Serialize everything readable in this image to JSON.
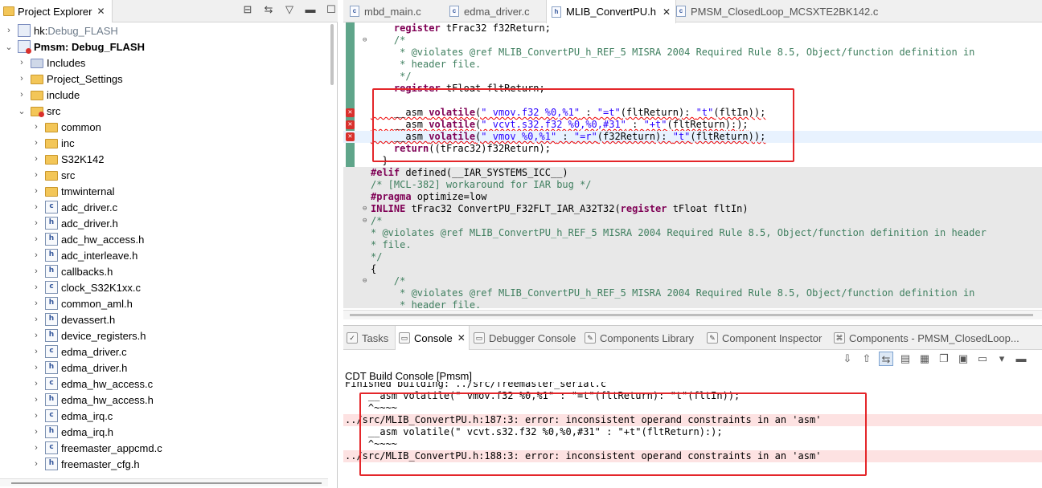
{
  "explorer": {
    "title": "Project Explorer",
    "close": "✕",
    "tree": [
      {
        "level": 0,
        "chev": "›",
        "icon": "project",
        "label": "hk:",
        "suffix": " Debug_FLASH",
        "bold": false
      },
      {
        "level": 0,
        "chev": "⌄",
        "icon": "project-err",
        "label": "Pmsm: Debug_FLASH",
        "suffix": "",
        "bold": true
      },
      {
        "level": 1,
        "chev": "›",
        "icon": "includes",
        "label": "Includes",
        "suffix": "",
        "bold": false
      },
      {
        "level": 1,
        "chev": "›",
        "icon": "folder",
        "label": "Project_Settings",
        "suffix": "",
        "bold": false
      },
      {
        "level": 1,
        "chev": "›",
        "icon": "folder",
        "label": "include",
        "suffix": "",
        "bold": false
      },
      {
        "level": 1,
        "chev": "⌄",
        "icon": "src-err",
        "label": "src",
        "suffix": "",
        "bold": false
      },
      {
        "level": 2,
        "chev": "›",
        "icon": "folder",
        "label": "common",
        "suffix": "",
        "bold": false
      },
      {
        "level": 2,
        "chev": "›",
        "icon": "folder",
        "label": "inc",
        "suffix": "",
        "bold": false
      },
      {
        "level": 2,
        "chev": "›",
        "icon": "folder",
        "label": "S32K142",
        "suffix": "",
        "bold": false
      },
      {
        "level": 2,
        "chev": "›",
        "icon": "folder",
        "label": "src",
        "suffix": "",
        "bold": false
      },
      {
        "level": 2,
        "chev": "›",
        "icon": "folder",
        "label": "tmwinternal",
        "suffix": "",
        "bold": false
      },
      {
        "level": 2,
        "chev": "›",
        "icon": "c",
        "label": "adc_driver.c",
        "suffix": "",
        "bold": false
      },
      {
        "level": 2,
        "chev": "›",
        "icon": "h",
        "label": "adc_driver.h",
        "suffix": "",
        "bold": false
      },
      {
        "level": 2,
        "chev": "›",
        "icon": "h",
        "label": "adc_hw_access.h",
        "suffix": "",
        "bold": false
      },
      {
        "level": 2,
        "chev": "›",
        "icon": "h",
        "label": "adc_interleave.h",
        "suffix": "",
        "bold": false
      },
      {
        "level": 2,
        "chev": "›",
        "icon": "h",
        "label": "callbacks.h",
        "suffix": "",
        "bold": false
      },
      {
        "level": 2,
        "chev": "›",
        "icon": "c",
        "label": "clock_S32K1xx.c",
        "suffix": "",
        "bold": false
      },
      {
        "level": 2,
        "chev": "›",
        "icon": "h",
        "label": "common_aml.h",
        "suffix": "",
        "bold": false
      },
      {
        "level": 2,
        "chev": "›",
        "icon": "h",
        "label": "devassert.h",
        "suffix": "",
        "bold": false
      },
      {
        "level": 2,
        "chev": "›",
        "icon": "h",
        "label": "device_registers.h",
        "suffix": "",
        "bold": false
      },
      {
        "level": 2,
        "chev": "›",
        "icon": "c",
        "label": "edma_driver.c",
        "suffix": "",
        "bold": false
      },
      {
        "level": 2,
        "chev": "›",
        "icon": "h",
        "label": "edma_driver.h",
        "suffix": "",
        "bold": false
      },
      {
        "level": 2,
        "chev": "›",
        "icon": "c",
        "label": "edma_hw_access.c",
        "suffix": "",
        "bold": false
      },
      {
        "level": 2,
        "chev": "›",
        "icon": "h",
        "label": "edma_hw_access.h",
        "suffix": "",
        "bold": false
      },
      {
        "level": 2,
        "chev": "›",
        "icon": "c",
        "label": "edma_irq.c",
        "suffix": "",
        "bold": false
      },
      {
        "level": 2,
        "chev": "›",
        "icon": "h",
        "label": "edma_irq.h",
        "suffix": "",
        "bold": false
      },
      {
        "level": 2,
        "chev": "›",
        "icon": "c",
        "label": "freemaster_appcmd.c",
        "suffix": "",
        "bold": false
      },
      {
        "level": 2,
        "chev": "›",
        "icon": "h",
        "label": "freemaster_cfg.h",
        "suffix": "",
        "bold": false
      }
    ]
  },
  "editor": {
    "tabs": [
      {
        "label": "mbd_main.c",
        "active": false
      },
      {
        "label": "edma_driver.c",
        "active": false
      },
      {
        "label": "MLIB_ConvertPU.h",
        "active": true,
        "close": "✕"
      },
      {
        "label": "PMSM_ClosedLoop_MCSXTE2BK142.c",
        "active": false
      }
    ],
    "lines": [
      {
        "text": "    register tFrac32 f32Return;",
        "style": "plain"
      },
      {
        "text": "    /*",
        "style": "comment",
        "fold": "⊖"
      },
      {
        "text": "     * @violates @ref MLIB_ConvertPU_h_REF_5 MISRA 2004 Required Rule 8.5, Object/function definition in",
        "style": "comment"
      },
      {
        "text": "     * header file.",
        "style": "comment"
      },
      {
        "text": "     */",
        "style": "comment"
      },
      {
        "text": "    register tFloat fltReturn;",
        "style": "plain"
      },
      {
        "text": "",
        "style": "plain"
      },
      {
        "text": "    __asm volatile(\" vmov.f32 %0,%1\" : \"=t\"(fltReturn): \"t\"(fltIn));",
        "style": "error"
      },
      {
        "text": "    __asm volatile(\" vcvt.s32.f32 %0,%0,#31\" : \"+t\"(fltReturn):);",
        "style": "error"
      },
      {
        "text": "    __asm volatile(\" vmov %0,%1\" : \"=r\"(f32Return): \"t\"(fltReturn));",
        "style": "error-hl"
      },
      {
        "text": "    return((tFrac32)f32Return);",
        "style": "plain"
      },
      {
        "text": "  }",
        "style": "plain"
      },
      {
        "text": "#elif defined(__IAR_SYSTEMS_ICC__)",
        "style": "grey-dir"
      },
      {
        "text": "/* [MCL-382] workaround for IAR bug */",
        "style": "grey-comment"
      },
      {
        "text": "#pragma optimize=low",
        "style": "grey-dir"
      },
      {
        "text": "INLINE tFrac32 ConvertPU_F32FLT_IAR_A32T32(register tFloat fltIn)",
        "style": "grey",
        "fold": "⊖"
      },
      {
        "text": "/*",
        "style": "grey-comment",
        "fold": "⊖"
      },
      {
        "text": "* @violates @ref MLIB_ConvertPU_h_REF_5 MISRA 2004 Required Rule 8.5, Object/function definition in header",
        "style": "grey-comment"
      },
      {
        "text": "* file.",
        "style": "grey-comment"
      },
      {
        "text": "*/",
        "style": "grey-comment"
      },
      {
        "text": "{",
        "style": "grey"
      },
      {
        "text": "    /*",
        "style": "grey-comment",
        "fold": "⊖"
      },
      {
        "text": "     * @violates @ref MLIB_ConvertPU_h_REF_5 MISRA 2004 Required Rule 8.5, Object/function definition in",
        "style": "grey-comment"
      },
      {
        "text": "     * header file.",
        "style": "grey-comment"
      }
    ]
  },
  "console": {
    "tabs": [
      {
        "label": "Tasks",
        "active": false,
        "icon": "tasks-icon"
      },
      {
        "label": "Console",
        "active": true,
        "icon": "console-icon",
        "close": "✕"
      },
      {
        "label": "Debugger Console",
        "active": false,
        "icon": "debugger-console-icon"
      },
      {
        "label": "Components Library",
        "active": false,
        "icon": "components-library-icon"
      },
      {
        "label": "Component Inspector",
        "active": false,
        "icon": "component-inspector-icon"
      },
      {
        "label": "Components - PMSM_ClosedLoop...",
        "active": false,
        "icon": "components-icon"
      }
    ],
    "title": "CDT Build Console [Pmsm]",
    "lines": [
      {
        "text": "Finished building: ../src/freemaster_serial.c",
        "err": false,
        "clip": true
      },
      {
        "text": "    __asm volatile(\" vmov.f32 %0,%1\" : \"=t\"(fltReturn): \"t\"(fltIn));",
        "err": false
      },
      {
        "text": "    ^~~~~",
        "err": false
      },
      {
        "text": "../src/MLIB_ConvertPU.h:187:3: error: inconsistent operand constraints in an 'asm'",
        "err": true
      },
      {
        "text": "    __asm volatile(\" vcvt.s32.f32 %0,%0,#31\" : \"+t\"(fltReturn):);",
        "err": false
      },
      {
        "text": "    ^~~~~",
        "err": false
      },
      {
        "text": "../src/MLIB_ConvertPU.h:188:3: error: inconsistent operand constraints in an 'asm'",
        "err": true
      }
    ]
  },
  "colors": {
    "error_red": "#e4262a",
    "error_bg": "#fde2e2",
    "keyword": "#7f0055",
    "comment": "#3f7f5f",
    "string": "#2a00ff"
  }
}
